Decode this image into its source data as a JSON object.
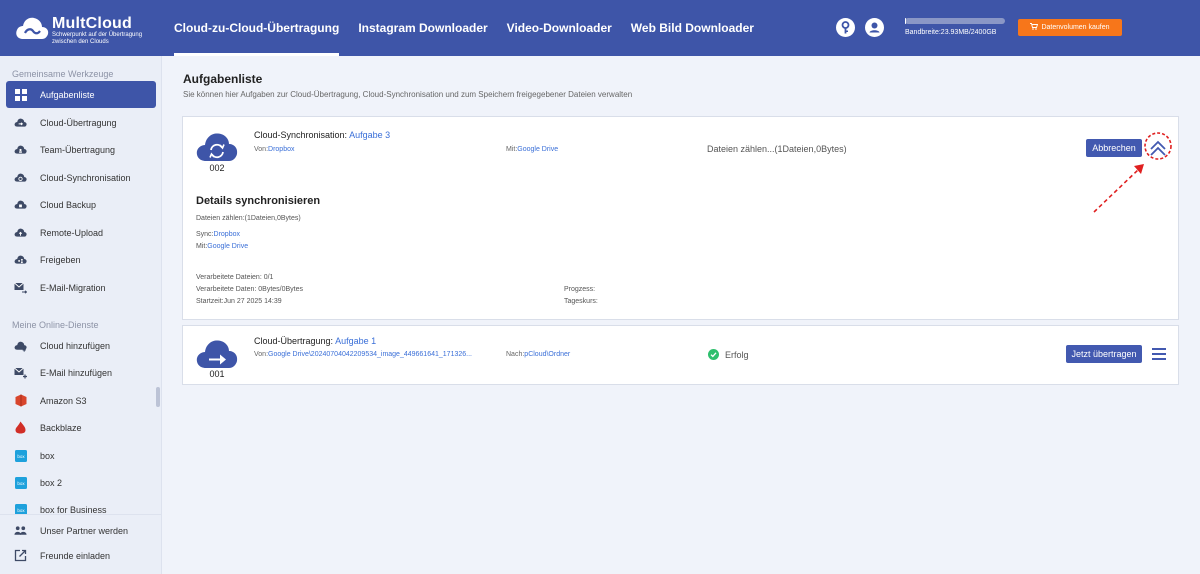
{
  "app": {
    "title": "MultCloud",
    "subtitle": "Schwerpunkt auf der Übertragung zwischen den Clouds"
  },
  "nav": {
    "items": [
      {
        "label": "Cloud-zu-Cloud-Übertragung",
        "active": true
      },
      {
        "label": "Instagram Downloader",
        "active": false
      },
      {
        "label": "Video-Downloader",
        "active": false
      },
      {
        "label": "Web Bild Downloader",
        "active": false
      }
    ]
  },
  "header": {
    "bandwidth_label": "Bandbreite:23.93MB/2400GB",
    "bandwidth_used_fraction": 0.01,
    "buy_button": "Datenvolumen kaufen",
    "icons": [
      "key-icon",
      "user-icon"
    ]
  },
  "sidebar": {
    "section1": "Gemeinsame Werkzeuge",
    "tools": [
      {
        "label": "Aufgabenliste",
        "icon": "grid-icon",
        "active": true
      },
      {
        "label": "Cloud-Übertragung",
        "icon": "cloud-transfer-icon",
        "active": false
      },
      {
        "label": "Team-Übertragung",
        "icon": "team-transfer-icon",
        "active": false
      },
      {
        "label": "Cloud-Synchronisation",
        "icon": "cloud-sync-icon",
        "active": false
      },
      {
        "label": "Cloud Backup",
        "icon": "cloud-backup-icon",
        "active": false
      },
      {
        "label": "Remote-Upload",
        "icon": "remote-upload-icon",
        "active": false
      },
      {
        "label": "Freigeben",
        "icon": "share-icon",
        "active": false
      },
      {
        "label": "E-Mail-Migration",
        "icon": "email-migration-icon",
        "active": false
      }
    ],
    "section2": "Meine Online-Dienste",
    "services": [
      {
        "label": "Cloud hinzufügen",
        "icon": "add-cloud-icon"
      },
      {
        "label": "E-Mail hinzufügen",
        "icon": "add-email-icon"
      },
      {
        "label": "Amazon S3",
        "icon": "amazon-s3-icon"
      },
      {
        "label": "Backblaze",
        "icon": "backblaze-icon"
      },
      {
        "label": "box",
        "icon": "box-icon"
      },
      {
        "label": "box 2",
        "icon": "box-icon"
      },
      {
        "label": "box for Business",
        "icon": "box-icon"
      }
    ],
    "bottom": [
      {
        "label": "Unser Partner werden",
        "icon": "partner-icon"
      },
      {
        "label": "Freunde einladen",
        "icon": "invite-icon"
      }
    ]
  },
  "main": {
    "title": "Aufgabenliste",
    "subtitle": "Sie können hier Aufgaben zur Cloud-Übertragung, Cloud-Synchronisation und zum Speichern freigegebener Dateien verwalten",
    "task1": {
      "number": "002",
      "type": "Cloud-Synchronisation:",
      "name": "Aufgabe 3",
      "from_label": "Von:",
      "from_value": "Dropbox",
      "to_label": "Mit:",
      "to_value": "Google Drive",
      "status": "Dateien zählen...(1Dateien,0Bytes)",
      "cancel_button": "Abbrechen",
      "details": {
        "title": "Details synchronisieren",
        "count": "Dateien zählen:(1Dateien,0Bytes)",
        "sync_label": "Sync:",
        "sync_value": "Dropbox",
        "with_label": "Mit:",
        "with_value": "Google Drive",
        "processed_files": "Verarbeitete Dateien: 0/1",
        "processed_data": "Verarbeitete Daten: 0Bytes/0Bytes",
        "start_time": "Startzeit:Jun 27 2025 14:39",
        "progress": "Progzess:",
        "daily_rate": "Tageskurs:"
      }
    },
    "task2": {
      "number": "001",
      "type": "Cloud-Übertragung:",
      "name": "Aufgabe 1",
      "from_label": "Von:",
      "from_value": "Google Drive\\20240704042209534_image_449661641_171326...",
      "to_label": "Nach:",
      "to_value": "pCloud\\Ordner",
      "status": "Erfolg",
      "transfer_button": "Jetzt übertragen"
    }
  },
  "colors": {
    "primary": "#3e55a8",
    "accent_orange": "#f7761a",
    "link": "#3a6fd8",
    "success": "#2ebf6d",
    "annotation": "#e02020"
  }
}
